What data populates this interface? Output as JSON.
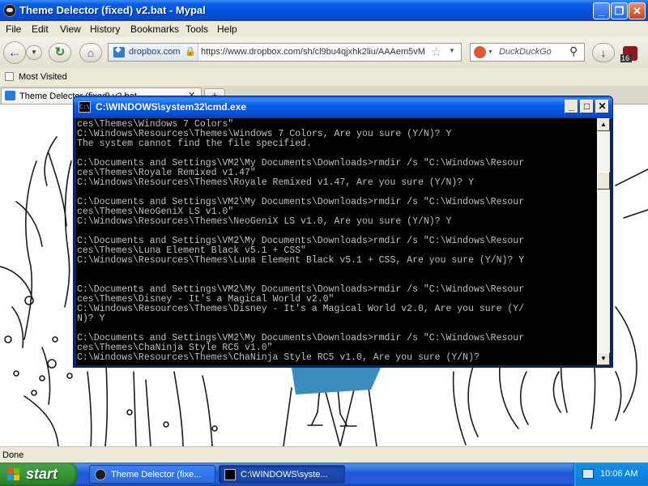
{
  "browser": {
    "title": "Theme Delector (fixed) v2.bat - Mypal",
    "menu": [
      "File",
      "Edit",
      "View",
      "History",
      "Bookmarks",
      "Tools",
      "Help"
    ],
    "url_host": "dropbox.com",
    "url": "https://www.dropbox.com/sh/cl9bu4qjxhk2liu/AAAem5vM",
    "search_engine": "DuckDuckGo",
    "bookmark": "Most Visited",
    "tab_label": "Theme Delector (fixed) v2.bat",
    "badge_count": "16",
    "status": "Done"
  },
  "cmd": {
    "title": "C:\\WINDOWS\\system32\\cmd.exe",
    "lines": [
      "ces\\Themes\\Windows 7 Colors\"",
      "C:\\Windows\\Resources\\Themes\\Windows 7 Colors, Are you sure (Y/N)? Y",
      "The system cannot find the file specified.",
      "",
      "C:\\Documents and Settings\\VM2\\My Documents\\Downloads>rmdir /s \"C:\\Windows\\Resour",
      "ces\\Themes\\Royale Remixed v1.47\"",
      "C:\\Windows\\Resources\\Themes\\Royale Remixed v1.47, Are you sure (Y/N)? Y",
      "",
      "C:\\Documents and Settings\\VM2\\My Documents\\Downloads>rmdir /s \"C:\\Windows\\Resour",
      "ces\\Themes\\NeoGeniX LS v1.0\"",
      "C:\\Windows\\Resources\\Themes\\NeoGeniX LS v1.0, Are you sure (Y/N)? Y",
      "",
      "C:\\Documents and Settings\\VM2\\My Documents\\Downloads>rmdir /s \"C:\\Windows\\Resour",
      "ces\\Themes\\Luna Element Black v5.1 + CSS\"",
      "C:\\Windows\\Resources\\Themes\\Luna Element Black v5.1 + CSS, Are you sure (Y/N)? Y",
      "",
      "",
      "C:\\Documents and Settings\\VM2\\My Documents\\Downloads>rmdir /s \"C:\\Windows\\Resour",
      "ces\\Themes\\Disney - It's a Magical World v2.0\"",
      "C:\\Windows\\Resources\\Themes\\Disney - It's a Magical World v2.0, Are you sure (Y/",
      "N)? Y",
      "",
      "C:\\Documents and Settings\\VM2\\My Documents\\Downloads>rmdir /s \"C:\\Windows\\Resour",
      "ces\\Themes\\ChaNinja Style RC5 v1.0\"",
      "C:\\Windows\\Resources\\Themes\\ChaNinja Style RC5 v1.0, Are you sure (Y/N)?"
    ]
  },
  "taskbar": {
    "start_label": "start",
    "tasks": [
      "Theme Delector (fixe...",
      "C:\\WINDOWS\\syste..."
    ],
    "clock": "10:06 AM"
  },
  "colors": {
    "xp_blue": "#0052dd",
    "start_green": "#3c9a3c",
    "console_text": "#c0c0c0",
    "dress_blue": "#3b8bbf"
  }
}
